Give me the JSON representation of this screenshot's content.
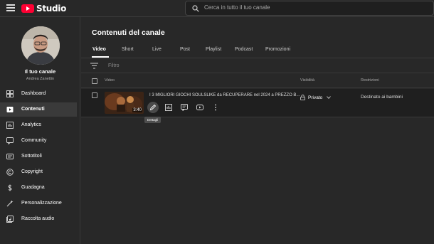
{
  "topbar": {
    "logo_text": "Studio",
    "search_placeholder": "Cerca in tutto il tuo canale"
  },
  "sidebar": {
    "channel_name": "Il tuo canale",
    "channel_owner": "Andrea Zanettin",
    "items": [
      {
        "label": "Dashboard",
        "icon": "dashboard-icon",
        "active": false
      },
      {
        "label": "Contenuti",
        "icon": "content-icon",
        "active": true
      },
      {
        "label": "Analytics",
        "icon": "analytics-icon",
        "active": false
      },
      {
        "label": "Community",
        "icon": "community-icon",
        "active": false
      },
      {
        "label": "Sottotitoli",
        "icon": "subtitles-icon",
        "active": false
      },
      {
        "label": "Copyright",
        "icon": "copyright-icon",
        "active": false
      },
      {
        "label": "Guadagna",
        "icon": "dollar-icon",
        "active": false
      },
      {
        "label": "Personalizzazione",
        "icon": "magic-wand-icon",
        "active": false
      },
      {
        "label": "Raccolta audio",
        "icon": "audio-library-icon",
        "active": false
      }
    ]
  },
  "main": {
    "title": "Contenuti del canale",
    "tabs": [
      "Video",
      "Short",
      "Live",
      "Post",
      "Playlist",
      "Podcast",
      "Promozioni"
    ],
    "active_tab": "Video",
    "filter_placeholder": "Filtro",
    "columns": {
      "video": "Video",
      "visibility": "Visibilità",
      "restrictions": "Restrizioni"
    },
    "rows": [
      {
        "title": "I 3 MIGLIORI GIOCHI SOULSLIKE da RECUPERARE nel 2024 a PREZZO B...",
        "duration": "3:40",
        "visibility": "Privato",
        "restrictions": "Destinato ai bambini",
        "actions": [
          "pencil-icon",
          "analytics-icon",
          "comments-icon",
          "youtube-icon",
          "more-icon"
        ]
      }
    ],
    "tooltip": "Dettagli"
  },
  "colors": {
    "background": "#282828",
    "row_background": "#1f1f1f",
    "brand_red": "#ff0033"
  }
}
